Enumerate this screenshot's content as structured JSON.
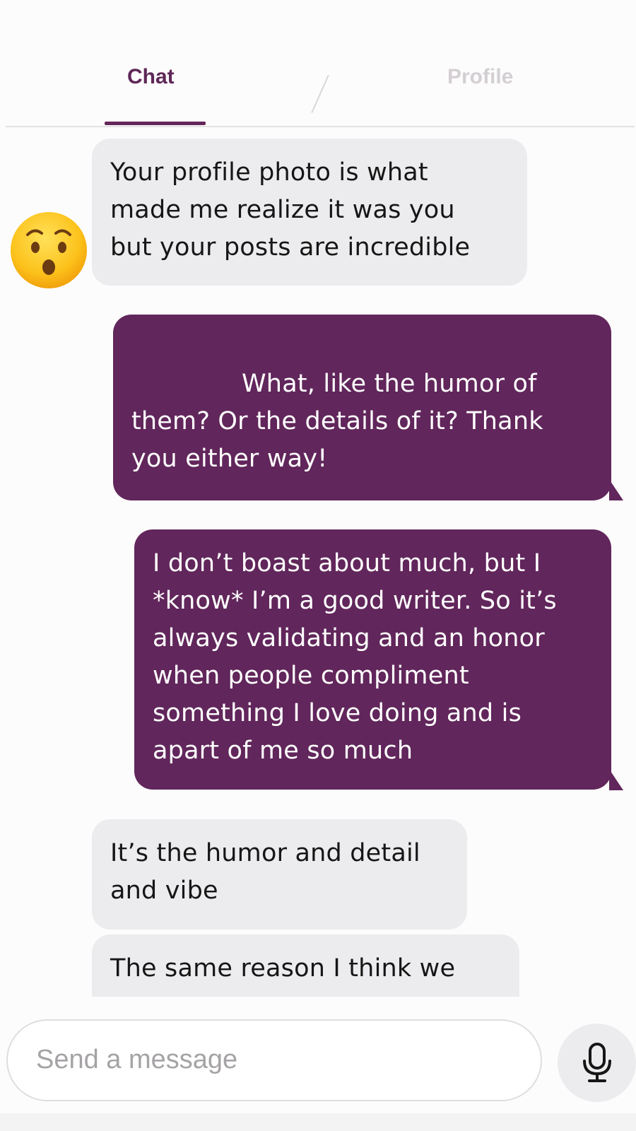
{
  "tabs": {
    "chat": "Chat",
    "profile": "Profile"
  },
  "messages": [
    {
      "direction": "incoming",
      "lines": [
        "Your profile photo is what",
        "made me realize it was you",
        "but your posts are incredible"
      ]
    },
    {
      "direction": "outgoing",
      "lines": [
        "What, like the humor of",
        "them? Or the details of it? Thank",
        "you either way!"
      ]
    },
    {
      "direction": "outgoing",
      "lines": [
        "I don’t boast about much, but I",
        "*know* I’m a good writer. So it’s",
        "always validating and an honor",
        "when people compliment",
        "something I love doing and is",
        "apart of me so much"
      ]
    },
    {
      "direction": "incoming",
      "lines": [
        "It’s the humor and detail",
        "and vibe"
      ]
    },
    {
      "direction": "incoming",
      "lines": [
        "The same reason I think we"
      ]
    }
  ],
  "reaction": {
    "icon": "hushed-face-emoji"
  },
  "composer": {
    "placeholder": "Send a message",
    "mic_icon": "microphone-icon"
  },
  "colors": {
    "accent": "#61265b",
    "incoming_bubble": "#ececee",
    "tab_inactive": "#d4cfd3"
  }
}
